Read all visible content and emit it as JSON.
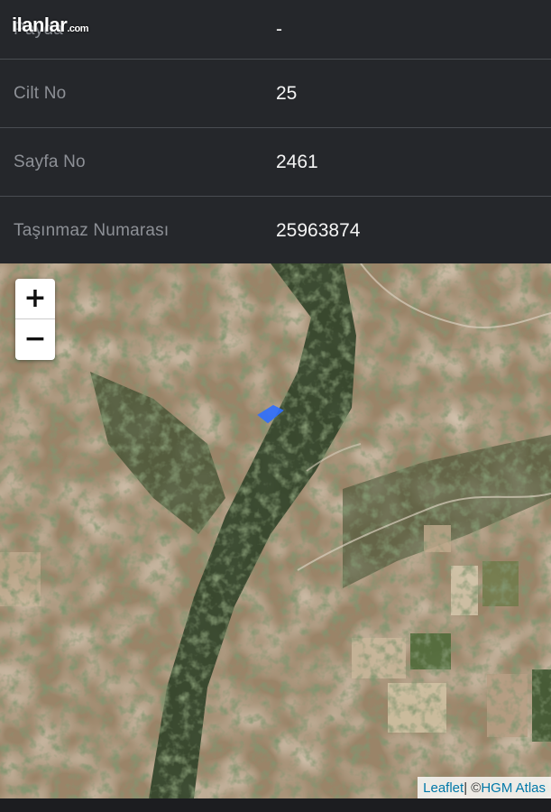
{
  "logo": {
    "brand": "ilanlar",
    "suffix": ".com"
  },
  "rows": [
    {
      "label": "Payda",
      "value": "-"
    },
    {
      "label": "Cilt No",
      "value": "25"
    },
    {
      "label": "Sayfa No",
      "value": "2461"
    },
    {
      "label": "Taşınmaz Numarası",
      "value": "25963874"
    }
  ],
  "map": {
    "zoom_in": "+",
    "zoom_out": "−",
    "attribution": {
      "leaflet": "Leaflet",
      "separator": " | © ",
      "provider": "HGM Atlas"
    },
    "parcel_color": "#2f6fff"
  }
}
